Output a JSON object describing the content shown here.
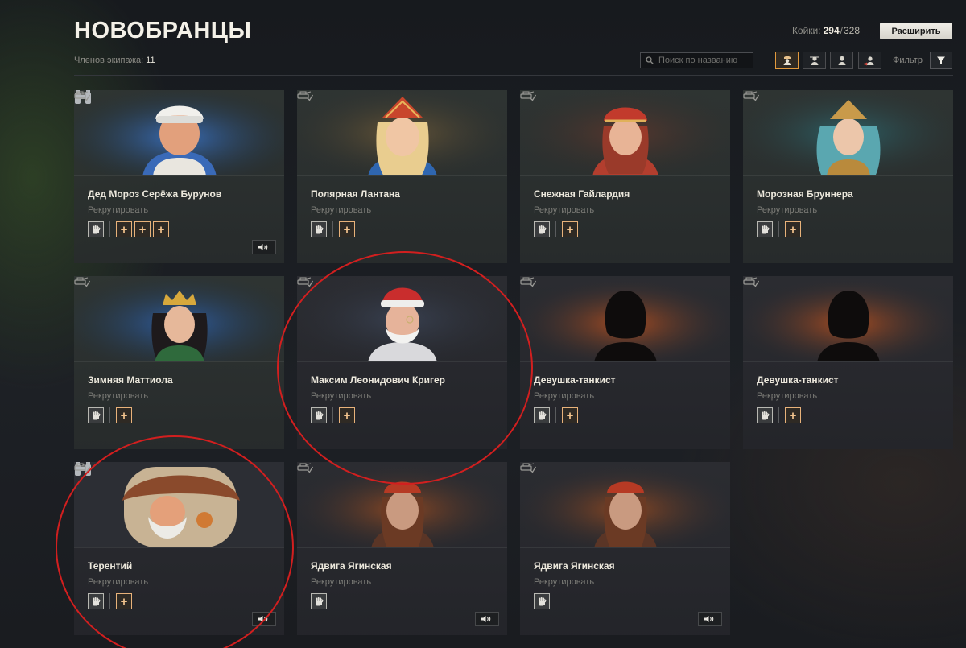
{
  "header": {
    "title": "НОВОБРАНЦЫ",
    "crew_label": "Членов экипажа:",
    "crew_count": "11",
    "bunks_label": "Койки:",
    "bunks_current": "294",
    "bunks_separator": "/",
    "bunks_max": "328",
    "expand_label": "Расширить",
    "search_placeholder": "Поиск по названию",
    "filter_label": "Фильтр"
  },
  "role_filters": [
    {
      "icon": "commander-role-icon",
      "active": true
    },
    {
      "icon": "gunner-role-icon",
      "active": false
    },
    {
      "icon": "driver-role-icon",
      "active": false
    },
    {
      "icon": "radio-operator-role-icon",
      "active": false
    }
  ],
  "cards": [
    {
      "name": "Дед Мороз Серёжа Бурунов",
      "recruit": "Рекрутировать",
      "slots": 3,
      "voice": true,
      "binoculars": true
    },
    {
      "name": "Полярная Лантана",
      "recruit": "Рекрутировать",
      "slots": 1,
      "voice": false,
      "binoculars": false
    },
    {
      "name": "Снежная Гайлардия",
      "recruit": "Рекрутировать",
      "slots": 1,
      "voice": false,
      "binoculars": false
    },
    {
      "name": "Морозная Бруннера",
      "recruit": "Рекрутировать",
      "slots": 1,
      "voice": false,
      "binoculars": false
    },
    {
      "name": "Зимняя Маттиола",
      "recruit": "Рекрутировать",
      "slots": 1,
      "voice": false,
      "binoculars": false
    },
    {
      "name": "Максим Леонидович Кригер",
      "recruit": "Рекрутировать",
      "slots": 1,
      "voice": false,
      "binoculars": false
    },
    {
      "name": "Девушка-танкист",
      "recruit": "Рекрутировать",
      "slots": 1,
      "voice": false,
      "binoculars": false
    },
    {
      "name": "Девушка-танкист",
      "recruit": "Рекрутировать",
      "slots": 1,
      "voice": false,
      "binoculars": false
    },
    {
      "name": "Терентий",
      "recruit": "Рекрутировать",
      "slots": 1,
      "voice": true,
      "binoculars": true
    },
    {
      "name": "Ядвига Ягинская",
      "recruit": "Рекрутировать",
      "slots": 0,
      "voice": true,
      "binoculars": false
    },
    {
      "name": "Ядвига Ягинская",
      "recruit": "Рекрутировать",
      "slots": 0,
      "voice": true,
      "binoculars": false
    }
  ],
  "colors": {
    "accent": "#e29a3d",
    "skill_slot": "#e8b27a",
    "annotation_circle": "#d21f1f"
  }
}
